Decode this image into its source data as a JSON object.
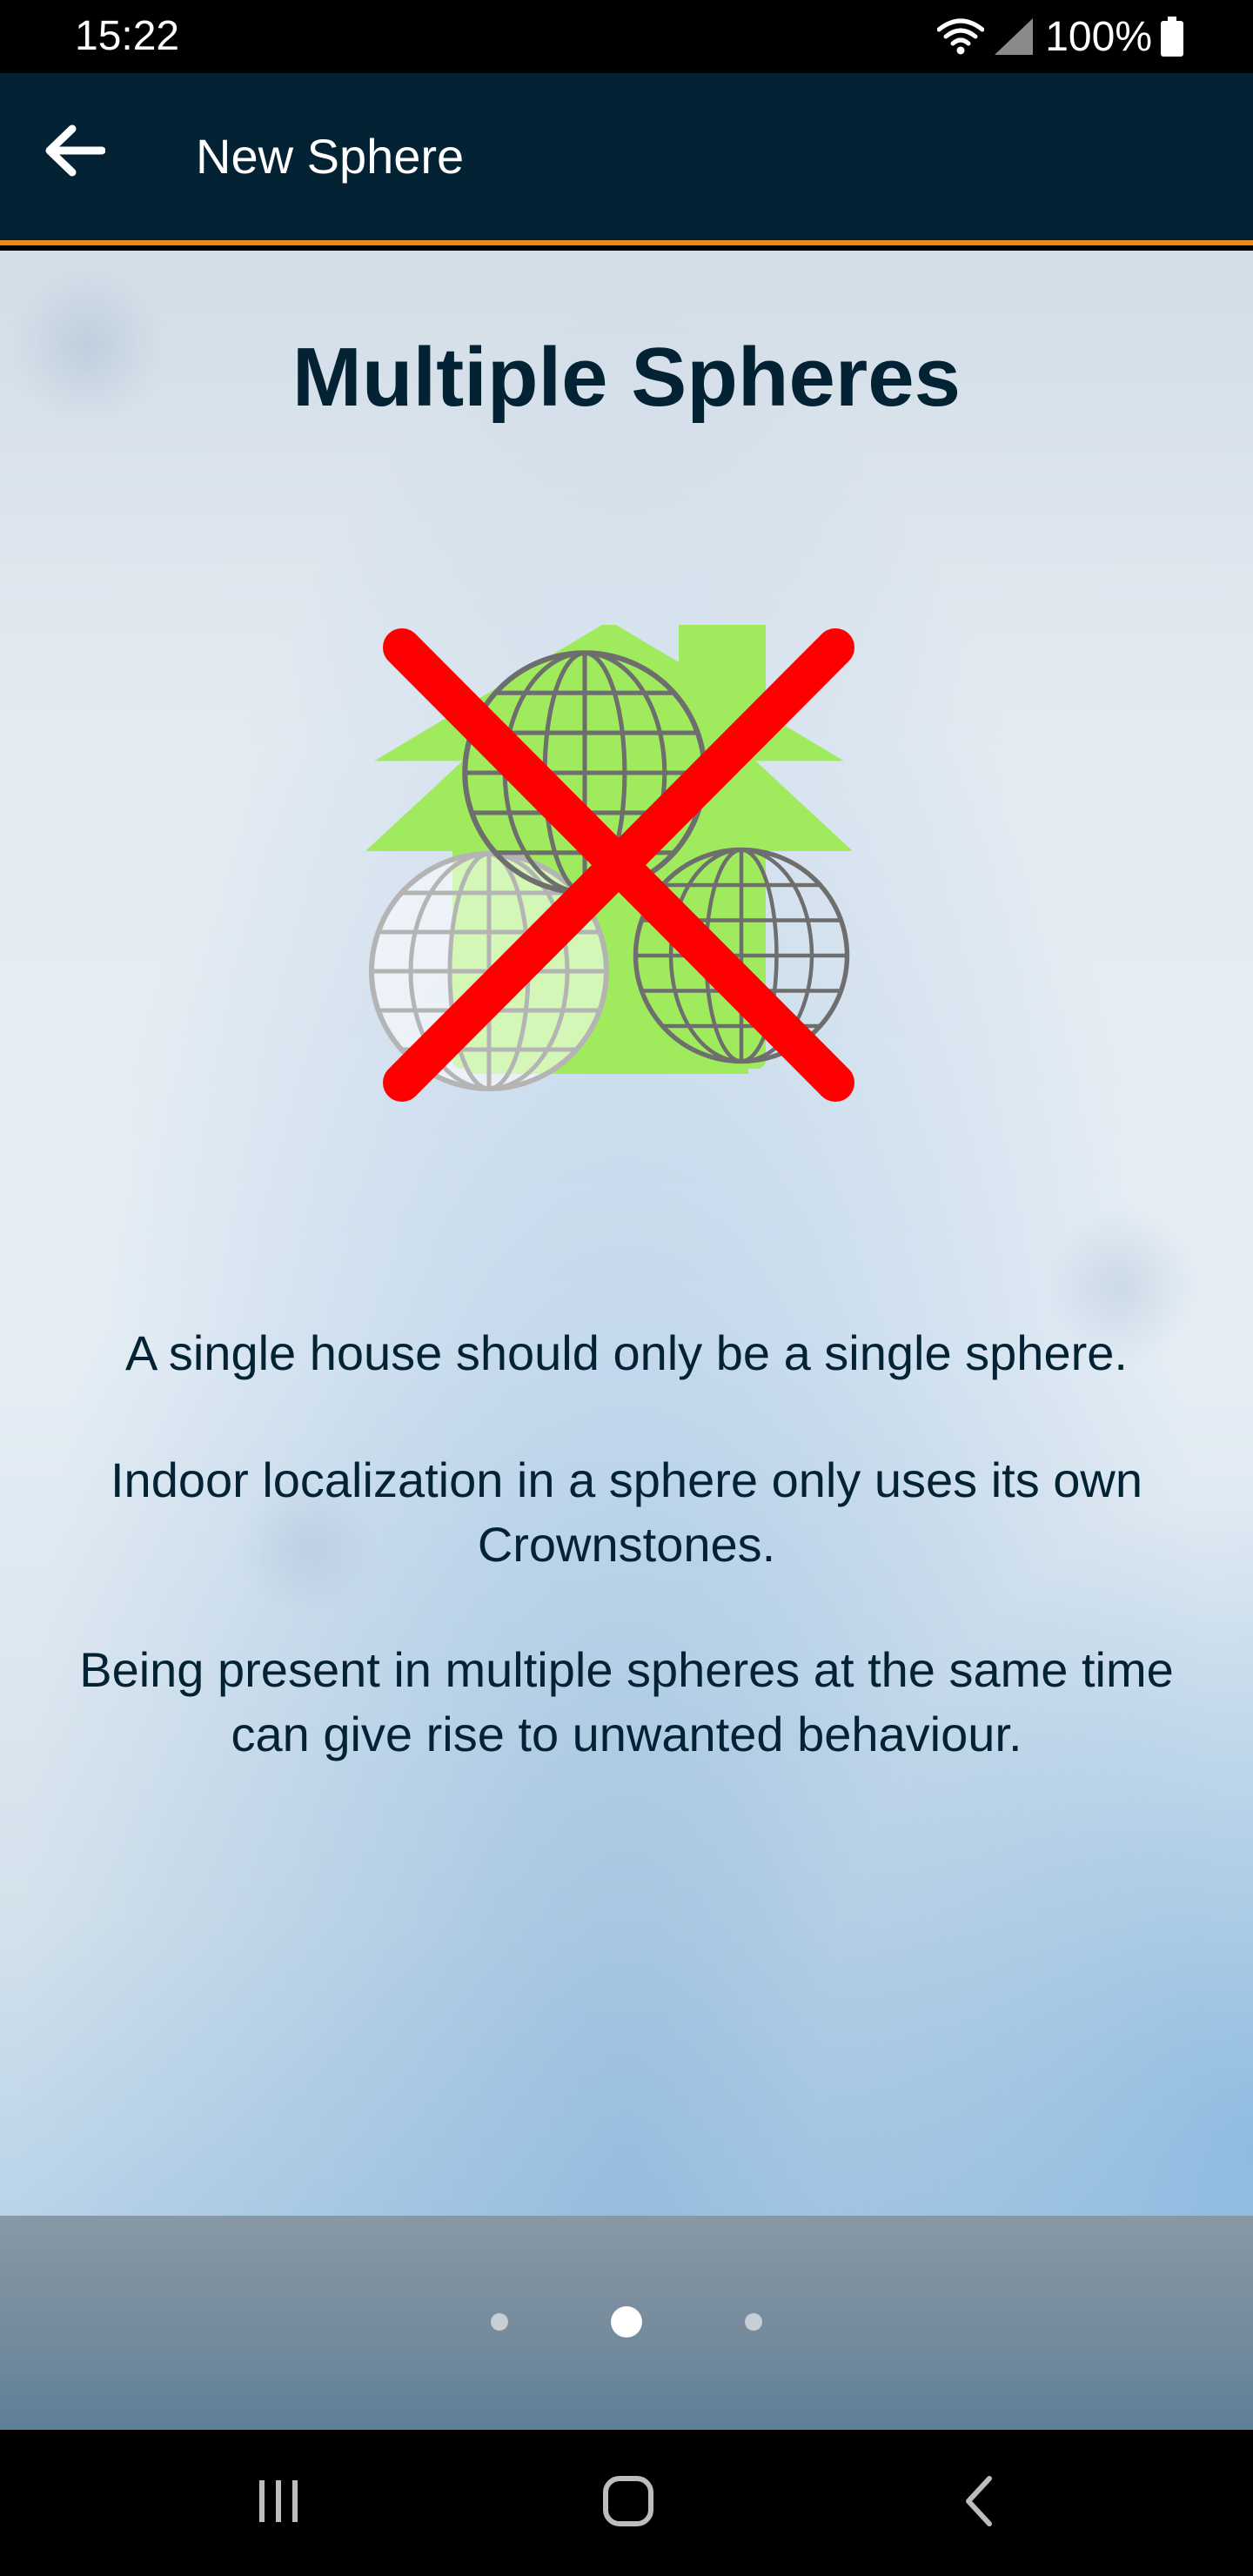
{
  "status_bar": {
    "time": "15:22",
    "battery_percent": "100%",
    "icons": [
      "wifi-icon",
      "signal-icon",
      "battery-icon"
    ]
  },
  "app_bar": {
    "title": "New Sphere",
    "back_icon": "arrow-left-icon",
    "background_color": "#032233",
    "accent_color": "#ed8a1b"
  },
  "main": {
    "title": "Multiple Spheres",
    "illustration": "house-with-multiple-globes-crossed-out",
    "paragraphs": [
      "A single house should only be a single sphere.",
      "Indoor localization in a sphere only uses its own Crownstones.",
      "Being present in multiple spheres at the same time can give rise to unwanted behaviour."
    ]
  },
  "pager": {
    "total_pages": 3,
    "current_page": 2
  },
  "nav_bar": {
    "buttons": [
      "recent-apps-icon",
      "home-icon",
      "back-icon"
    ]
  },
  "colors": {
    "text_dark": "#032233",
    "house_green": "#a0eb5d",
    "cross_red": "#ff0000"
  }
}
